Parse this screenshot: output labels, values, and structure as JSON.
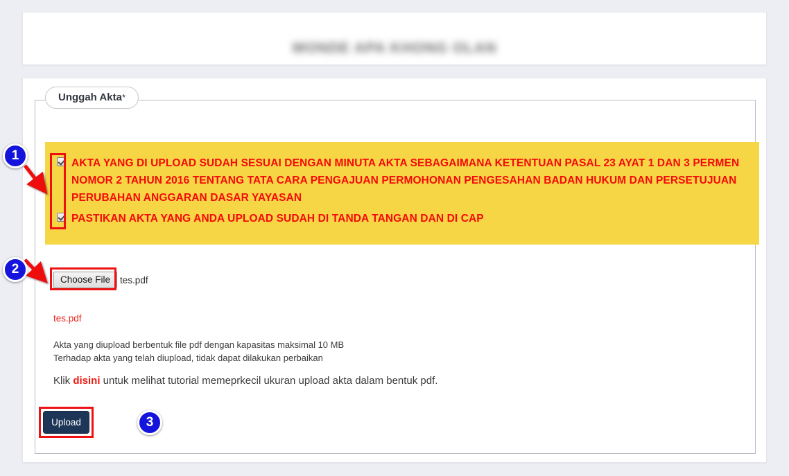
{
  "page": {
    "background_color": "#eceef3",
    "header_title": "MONDE APA KHONG OLAN"
  },
  "fieldset": {
    "legend_label": "Unggah Akta",
    "required_marker": "*"
  },
  "notice": {
    "background_color": "#f7d646",
    "text_color": "#f40a0a",
    "items": [
      {
        "checked": true,
        "text": "AKTA YANG DI UPLOAD SUDAH SESUAI DENGAN MINUTA AKTA SEBAGAIMANA KETENTUAN PASAL 23 AYAT 1 DAN 3 PERMEN NOMOR 2 TAHUN 2016 TENTANG TATA CARA PENGAJUAN PERMOHONAN PENGESAHAN BADAN HUKUM DAN PERSETUJUAN PERUBAHAN ANGGARAN DASAR YAYASAN"
      },
      {
        "checked": true,
        "text": "PASTIKAN AKTA YANG ANDA UPLOAD SUDAH DI TANDA TANGAN DAN DI CAP"
      }
    ]
  },
  "file_input": {
    "button_label": "Choose File",
    "file_name": "tes.pdf"
  },
  "uploaded_file_name": "tes.pdf",
  "hints": {
    "line1": "Akta yang diupload berbentuk file pdf dengan kapasitas maksimal 10 MB",
    "line2": "Terhadap akta yang telah diupload, tidak dapat dilakukan perbaikan"
  },
  "tutorial": {
    "prefix": "Klik ",
    "link_label": "disini",
    "suffix": " untuk melihat tutorial memeprkecil ukuran upload akta dalam bentuk pdf."
  },
  "upload_button": {
    "label": "Upload",
    "color": "#1d3557"
  },
  "annotations": {
    "highlight_color": "#ee1111",
    "badge_color": "#1414dc",
    "badges": [
      {
        "number": "1",
        "target": "checkboxes"
      },
      {
        "number": "2",
        "target": "choose-file"
      },
      {
        "number": "3",
        "target": "upload-button"
      }
    ]
  }
}
